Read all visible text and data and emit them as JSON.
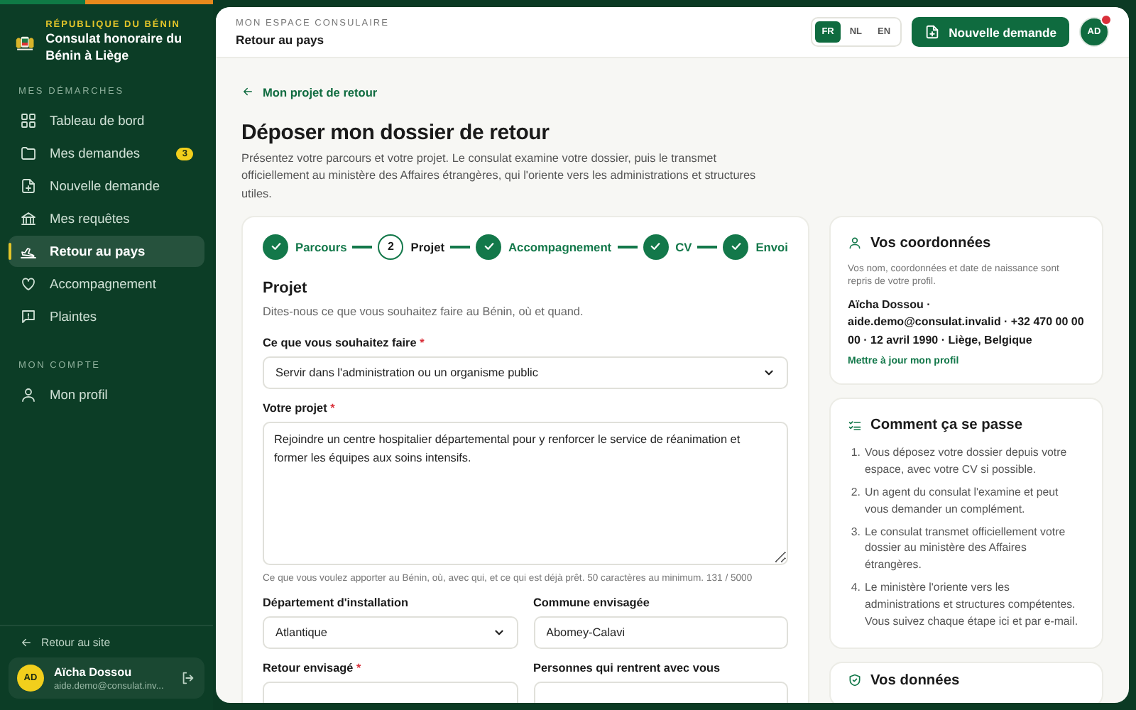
{
  "sidebar": {
    "country": "RÉPUBLIQUE DU BÉNIN",
    "org_name": "Consulat honoraire du Bénin à Liège",
    "sections": [
      {
        "title": "MES DÉMARCHES",
        "items": [
          {
            "label": "Tableau de bord",
            "selected": false
          },
          {
            "label": "Mes demandes",
            "badge": "3",
            "selected": false
          },
          {
            "label": "Nouvelle demande",
            "selected": false
          },
          {
            "label": "Mes requêtes",
            "selected": false
          },
          {
            "label": "Retour au pays",
            "selected": true
          },
          {
            "label": "Accompagnement",
            "selected": false
          },
          {
            "label": "Plaintes",
            "selected": false
          }
        ]
      },
      {
        "title": "MON COMPTE",
        "items": [
          {
            "label": "Mon profil",
            "selected": false
          }
        ]
      }
    ],
    "back_link": "Retour au site",
    "user": {
      "initials": "AD",
      "name": "Aïcha Dossou",
      "email": "aide.demo@consulat.inv..."
    }
  },
  "topbar": {
    "eyebrow": "MON ESPACE CONSULAIRE",
    "title": "Retour au pays",
    "languages": [
      {
        "label": "FR",
        "selected": true
      },
      {
        "label": "NL",
        "selected": false
      },
      {
        "label": "EN",
        "selected": false
      }
    ],
    "new_request": "Nouvelle demande",
    "avatar": {
      "initials": "AD",
      "notification": true
    }
  },
  "page": {
    "back_link": "Mon projet de retour",
    "title": "Déposer mon dossier de retour",
    "intro": "Présentez votre parcours et votre projet. Le consulat examine votre dossier, puis le transmet officiellement au ministère des Affaires étrangères, qui l'oriente vers les administrations et structures utiles."
  },
  "form": {
    "steps": [
      {
        "label": "Parcours",
        "completed": true
      },
      {
        "label": "Projet",
        "completed": false,
        "number": "2"
      },
      {
        "label": "Accompagnement",
        "completed": true
      },
      {
        "label": "CV",
        "completed": true
      },
      {
        "label": "Envoi",
        "completed": true
      }
    ],
    "section_title": "Projet",
    "section_hint": "Dites-nous ce que vous souhaitez faire au Bénin, où et quand.",
    "rows": [
      {
        "fields": [
          {
            "kind": "select",
            "label": "Ce que vous souhaitez faire",
            "required_mark": "*",
            "value": "Servir dans l'administration ou un organisme public"
          }
        ]
      },
      {
        "fields": [
          {
            "kind": "textarea",
            "label": "Votre projet",
            "required_mark": "*",
            "value": "Rejoindre un centre hospitalier départemental pour y renforcer le service de réanimation et former les équipes aux soins intensifs.",
            "help": "Ce que vous voulez apporter au Bénin, où, avec qui, et ce qui est déjà prêt. 50 caractères au minimum.",
            "counter": "131 / 5000"
          }
        ]
      },
      {
        "fields": [
          {
            "kind": "select",
            "label": "Département d'installation",
            "value": "Atlantique"
          },
          {
            "kind": "text",
            "label": "Commune envisagée",
            "value": "Abomey-Calavi"
          }
        ]
      },
      {
        "fields": [
          {
            "kind": "text",
            "label": "Retour envisagé",
            "required_mark": "*"
          },
          {
            "kind": "text",
            "label": "Personnes qui rentrent avec vous"
          }
        ]
      }
    ]
  },
  "aside": {
    "cards": [
      {
        "kind": "contact",
        "title": "Vos coordonnées",
        "note": "Vos nom, coordonnées et date de naissance sont repris de votre profil.",
        "details": "Aïcha Dossou · aide.demo@consulat.invalid · +32 470 00 00 00 · 12 avril 1990 · Liège, Belgique",
        "link": "Mettre à jour mon profil"
      },
      {
        "kind": "process",
        "title": "Comment ça se passe",
        "steps": [
          {
            "number": "1.",
            "text": "Vous déposez votre dossier depuis votre espace, avec votre CV si possible."
          },
          {
            "number": "2.",
            "text": "Un agent du consulat l'examine et peut vous demander un complément."
          },
          {
            "number": "3.",
            "text": "Le consulat transmet officiellement votre dossier au ministère des Affaires étrangères."
          },
          {
            "number": "4.",
            "text": "Le ministère l'oriente vers les administrations et structures compétentes. Vous suivez chaque étape ici et par e-mail."
          }
        ]
      },
      {
        "kind": "privacy",
        "title": "Vos données"
      }
    ]
  }
}
